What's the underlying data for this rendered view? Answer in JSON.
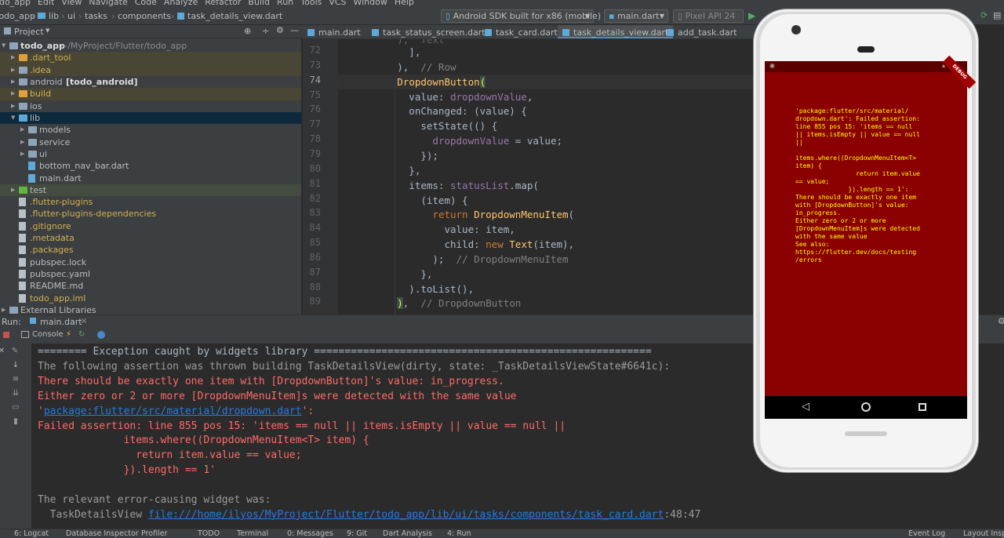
{
  "menubar": [
    "todo_app",
    "Edit",
    "View",
    "Navigate",
    "Code",
    "Analyze",
    "Refactor",
    "Build",
    "Run",
    "Tools",
    "VCS",
    "Window",
    "Help"
  ],
  "breadcrumbs": [
    "todo_app",
    "lib",
    "ui",
    "tasks",
    "components",
    "task_details_view.dart"
  ],
  "toolbar": {
    "device": "Android SDK built for x86 (mobile)",
    "config": "main.dart",
    "emulator": "Pixel API 24"
  },
  "project_panel": {
    "title": "Project",
    "root_name": "todo_app",
    "root_path": "~/MyProject/Flutter/todo_app"
  },
  "tree": [
    {
      "label": ".dart_tool",
      "indent": 1,
      "arrow": "▶",
      "icon": "folder-orange",
      "style": "y",
      "color": "#d0b053"
    },
    {
      "label": ".idea",
      "indent": 1,
      "arrow": "▶",
      "icon": "folder",
      "style": "y",
      "color": "#d0b053"
    },
    {
      "label": "android",
      "suffix": "[todo_android]",
      "indent": 1,
      "arrow": "▶",
      "icon": "folder",
      "style": "",
      "color": "#bbbbbb"
    },
    {
      "label": "build",
      "indent": 1,
      "arrow": "▶",
      "icon": "folder-orange",
      "style": "y",
      "color": "#d0b053"
    },
    {
      "label": "ios",
      "indent": 1,
      "arrow": "▶",
      "icon": "folder",
      "style": "",
      "color": "#bbbbbb"
    },
    {
      "label": "lib",
      "indent": 1,
      "arrow": "▼",
      "icon": "folder-blue",
      "style": "sel",
      "color": "#bbbbbb"
    },
    {
      "label": "models",
      "indent": 2,
      "arrow": "▶",
      "icon": "folder",
      "style": "",
      "color": "#bbbbbb"
    },
    {
      "label": "service",
      "indent": 2,
      "arrow": "▶",
      "icon": "folder",
      "style": "",
      "color": "#bbbbbb"
    },
    {
      "label": "ui",
      "indent": 2,
      "arrow": "▶",
      "icon": "folder",
      "style": "",
      "color": "#bbbbbb"
    },
    {
      "label": "bottom_nav_bar.dart",
      "indent": 2,
      "arrow": "",
      "icon": "dart",
      "style": "",
      "color": "#bbbbbb"
    },
    {
      "label": "main.dart",
      "indent": 2,
      "arrow": "",
      "icon": "dart",
      "style": "",
      "color": "#bbbbbb"
    },
    {
      "label": "test",
      "indent": 1,
      "arrow": "▶",
      "icon": "folder-green",
      "style": "gt",
      "color": "#bbbbbb"
    },
    {
      "label": ".flutter-plugins",
      "indent": 1,
      "arrow": "",
      "icon": "file",
      "style": "",
      "color": "#d0b053"
    },
    {
      "label": ".flutter-plugins-dependencies",
      "indent": 1,
      "arrow": "",
      "icon": "file",
      "style": "",
      "color": "#d0b053"
    },
    {
      "label": ".gitignore",
      "indent": 1,
      "arrow": "",
      "icon": "file",
      "style": "",
      "color": "#d0b053"
    },
    {
      "label": ".metadata",
      "indent": 1,
      "arrow": "",
      "icon": "file",
      "style": "",
      "color": "#d0b053"
    },
    {
      "label": ".packages",
      "indent": 1,
      "arrow": "",
      "icon": "file",
      "style": "",
      "color": "#d0b053"
    },
    {
      "label": "pubspec.lock",
      "indent": 1,
      "arrow": "",
      "icon": "file",
      "style": "",
      "color": "#bbbbbb"
    },
    {
      "label": "pubspec.yaml",
      "indent": 1,
      "arrow": "",
      "icon": "file",
      "style": "",
      "color": "#bbbbbb"
    },
    {
      "label": "README.md",
      "indent": 1,
      "arrow": "",
      "icon": "file",
      "style": "",
      "color": "#bbbbbb"
    },
    {
      "label": "todo_app.iml",
      "indent": 1,
      "arrow": "",
      "icon": "file",
      "style": "",
      "color": "#d0b053"
    },
    {
      "label": "External Libraries",
      "indent": 0,
      "arrow": "▶",
      "icon": "lib",
      "style": "",
      "color": "#bbbbbb"
    }
  ],
  "tabs": [
    {
      "label": "main.dart",
      "active": false
    },
    {
      "label": "task_status_screen.dart",
      "active": false
    },
    {
      "label": "task_card.dart",
      "active": false
    },
    {
      "label": "task_details_view.dart",
      "active": true
    },
    {
      "label": "add_task.dart",
      "active": false
    }
  ],
  "code": [
    {
      "num": "72",
      "html": "            ],"
    },
    {
      "num": "73",
      "html": "          ),  <span class=\"c\">// Row</span>"
    },
    {
      "num": "74",
      "html": "          <span class=\"g\">DropdownButton</span><span class=\"hl\">(</span>",
      "current": true
    },
    {
      "num": "75",
      "html": "            value: <span class=\"f\">dropdownValue</span>,"
    },
    {
      "num": "76",
      "html": "            onChanged: (value) {"
    },
    {
      "num": "77",
      "html": "              setState(() {"
    },
    {
      "num": "78",
      "html": "                <span class=\"f\">dropdownValue</span> = value;"
    },
    {
      "num": "79",
      "html": "              });"
    },
    {
      "num": "80",
      "html": "            },"
    },
    {
      "num": "81",
      "html": "            items: <span class=\"f\">statusList</span>.map("
    },
    {
      "num": "82",
      "html": "              (item) {"
    },
    {
      "num": "83",
      "html": "                <span class=\"k\">return</span> <span class=\"g\">DropdownMenuItem</span>("
    },
    {
      "num": "84",
      "html": "                  value: item,"
    },
    {
      "num": "85",
      "html": "                  child: <span class=\"k\">new</span> <span class=\"g\">Text</span>(item),"
    },
    {
      "num": "86",
      "html": "                );  <span class=\"c\">// DropdownMenuItem</span>"
    },
    {
      "num": "87",
      "html": "              },"
    },
    {
      "num": "88",
      "html": "            ).toList(),"
    },
    {
      "num": "89",
      "html": "          <span class=\"hl\">)</span>,  <span class=\"c\">// DropdownButton</span>"
    }
  ],
  "run": {
    "label": "Run:",
    "config": "main.dart",
    "console_tab": "Console"
  },
  "console": [
    {
      "cls": "",
      "text": "======== Exception caught by widgets library ======================================================="
    },
    {
      "cls": "gray",
      "text": "The following assertion was thrown building TaskDetailsView(dirty, state: _TaskDetailsViewState#6641c):"
    },
    {
      "cls": "red",
      "text": "There should be exactly one item with [DropdownButton]'s value: in_progress."
    },
    {
      "cls": "red",
      "text": "Either zero or 2 or more [DropdownMenuItem]s were detected with the same value"
    },
    {
      "cls": "red",
      "text": "'",
      "link": "package:flutter/src/material/dropdown.dart",
      "after": "':"
    },
    {
      "cls": "red",
      "text": "Failed assertion: line 855 pos 15: 'items == null || items.isEmpty || value == null ||"
    },
    {
      "cls": "red",
      "text": "              items.where((DropdownMenuItem<T> item) {"
    },
    {
      "cls": "red",
      "text": "                return item.value == value;"
    },
    {
      "cls": "red",
      "text": "              }).length == 1'"
    },
    {
      "cls": "",
      "text": ""
    },
    {
      "cls": "gray",
      "text": "The relevant error-causing widget was:"
    },
    {
      "cls": "gray",
      "text": "  TaskDetailsView ",
      "link": "file:///home/ilyos/MyProject/Flutter/todo_app/lib/ui/tasks/components/task_card.dart",
      "after": ":48:47"
    }
  ],
  "statusbar": [
    "6: Logcat",
    "Database Inspector",
    "Profiler",
    "TODO",
    "Terminal",
    "0: Messages",
    "9: Git",
    "Dart Analysis",
    "4: Run",
    "Event Log",
    "Layout Inspector"
  ],
  "phone": {
    "badge": "DEBUG",
    "error": "'package:flutter/src/material/\ndropdown.dart': Failed assertion:\nline 855 pos 15: 'items == null\n|| items.isEmpty || value == null\n||\n\nitems.where((DropdownMenuItem<T>\nitem) {\n                return item.value\n== value;\n              }).length == 1':\nThere should be exactly one item\nwith [DropdownButton]'s value:\nin_progress.\nEither zero or 2 or more\n[DropdownMenuItem]s were detected\nwith the same value\nSee also:\nhttps://flutter.dev/docs/testing\n/errors"
  },
  "colors": {
    "error_red": "#ff6b68",
    "phone_error_bg": "#8b0000",
    "phone_error_text": "#ffff00",
    "link": "#287bde"
  }
}
